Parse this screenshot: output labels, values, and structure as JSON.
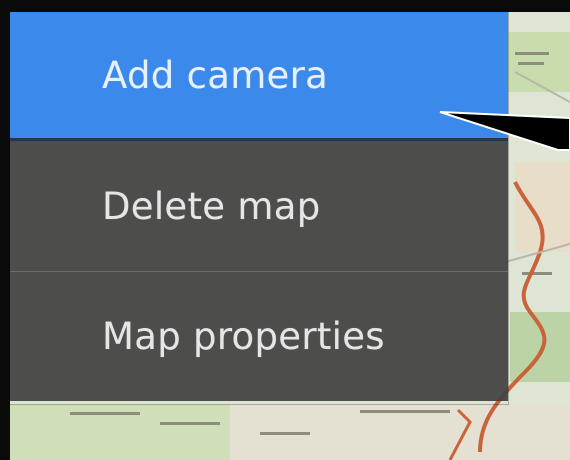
{
  "context_menu": {
    "items": [
      {
        "label": "Add camera",
        "state": "highlighted"
      },
      {
        "label": "Delete map",
        "state": "normal"
      },
      {
        "label": "Map properties",
        "state": "normal"
      }
    ]
  },
  "colors": {
    "highlight": "#3b89ea",
    "menu_background": "#424242",
    "frame": "#0a0a0a",
    "map_background": "#dfe5d5",
    "route": "#c9633b"
  },
  "icons": [
    "callout-arrow-icon"
  ]
}
